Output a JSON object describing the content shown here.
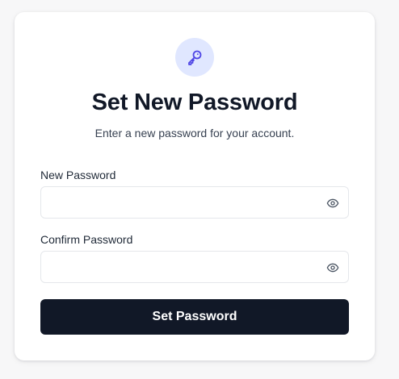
{
  "form": {
    "icon": "key-icon",
    "title": "Set New Password",
    "subtitle": "Enter a new password for your account.",
    "new_password": {
      "label": "New Password",
      "value": "",
      "placeholder": "",
      "toggle_icon": "eye-icon"
    },
    "confirm_password": {
      "label": "Confirm Password",
      "value": "",
      "placeholder": "",
      "toggle_icon": "eye-icon"
    },
    "submit_label": "Set Password"
  },
  "colors": {
    "accent": "#4f46e5",
    "accent_bg": "#e0e7ff",
    "button_bg": "#111827",
    "text_primary": "#111827",
    "border": "#e5e7eb"
  }
}
